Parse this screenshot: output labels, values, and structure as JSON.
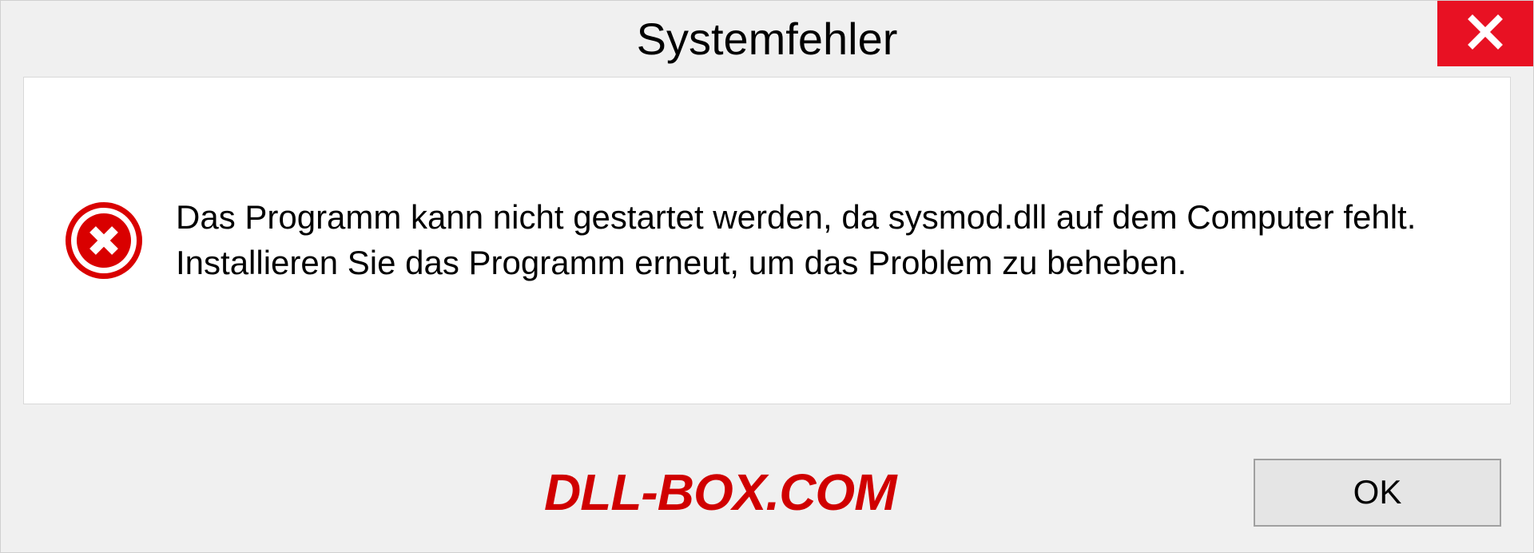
{
  "dialog": {
    "title": "Systemfehler",
    "message": "Das Programm kann nicht gestartet werden, da sysmod.dll auf dem Computer fehlt. Installieren Sie das Programm erneut, um das Problem zu beheben.",
    "ok_label": "OK"
  },
  "watermark": "DLL-BOX.COM",
  "colors": {
    "close_bg": "#e81123",
    "error_icon": "#d90000",
    "watermark": "#d00000"
  }
}
